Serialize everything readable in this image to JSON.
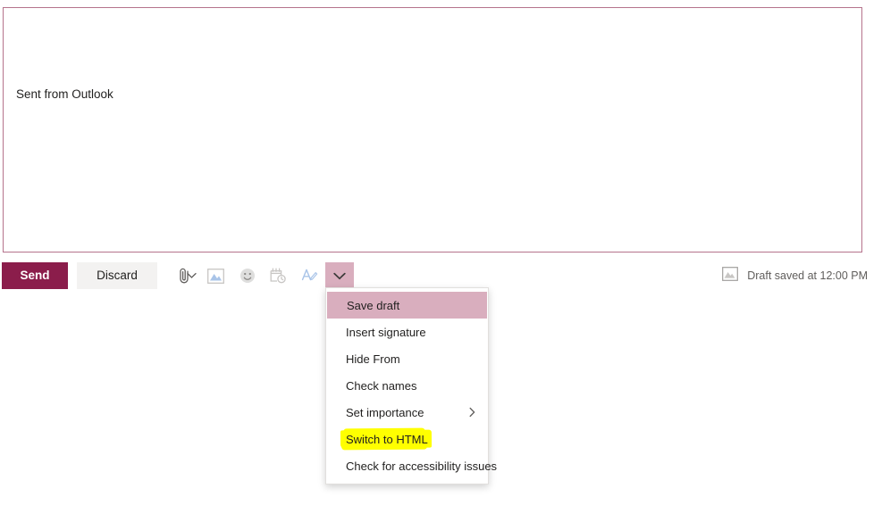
{
  "compose": {
    "body_text": "Sent from Outlook"
  },
  "toolbar": {
    "send_label": "Send",
    "discard_label": "Discard",
    "icons": [
      {
        "name": "attach-icon",
        "glyph": "attachment"
      },
      {
        "name": "attach-chevron-down-icon",
        "glyph": "chevron-down"
      },
      {
        "name": "insert-picture-icon",
        "glyph": "picture"
      },
      {
        "name": "emoji-icon",
        "glyph": "smiley"
      },
      {
        "name": "send-later-icon",
        "glyph": "calendar-clock"
      },
      {
        "name": "signature-icon",
        "glyph": "a-with-pen"
      },
      {
        "name": "more-options-chevron-down-icon",
        "glyph": "chevron-down"
      }
    ]
  },
  "status": {
    "icon": "picture-icon",
    "text": "Draft saved at 12:00 PM"
  },
  "menu": {
    "items": [
      {
        "label": "Save draft",
        "selected": true,
        "submenu": false,
        "highlighted": false
      },
      {
        "label": "Insert signature",
        "selected": false,
        "submenu": false,
        "highlighted": false
      },
      {
        "label": "Hide From",
        "selected": false,
        "submenu": false,
        "highlighted": false
      },
      {
        "label": "Check names",
        "selected": false,
        "submenu": false,
        "highlighted": false
      },
      {
        "label": "Set importance",
        "selected": false,
        "submenu": true,
        "highlighted": false
      },
      {
        "label": "Switch to HTML",
        "selected": false,
        "submenu": false,
        "highlighted": true
      },
      {
        "label": "Check for accessibility issues",
        "selected": false,
        "submenu": false,
        "highlighted": false
      }
    ]
  },
  "colors": {
    "send_button": "#8b1d4b",
    "discard_button": "#f3f2f1",
    "menu_selected": "#d9aebe",
    "compose_border": "#b5738c",
    "highlight": "#ffff00",
    "icon_blue": "#a9c4e8",
    "icon_grey": "#c8c6c4"
  }
}
